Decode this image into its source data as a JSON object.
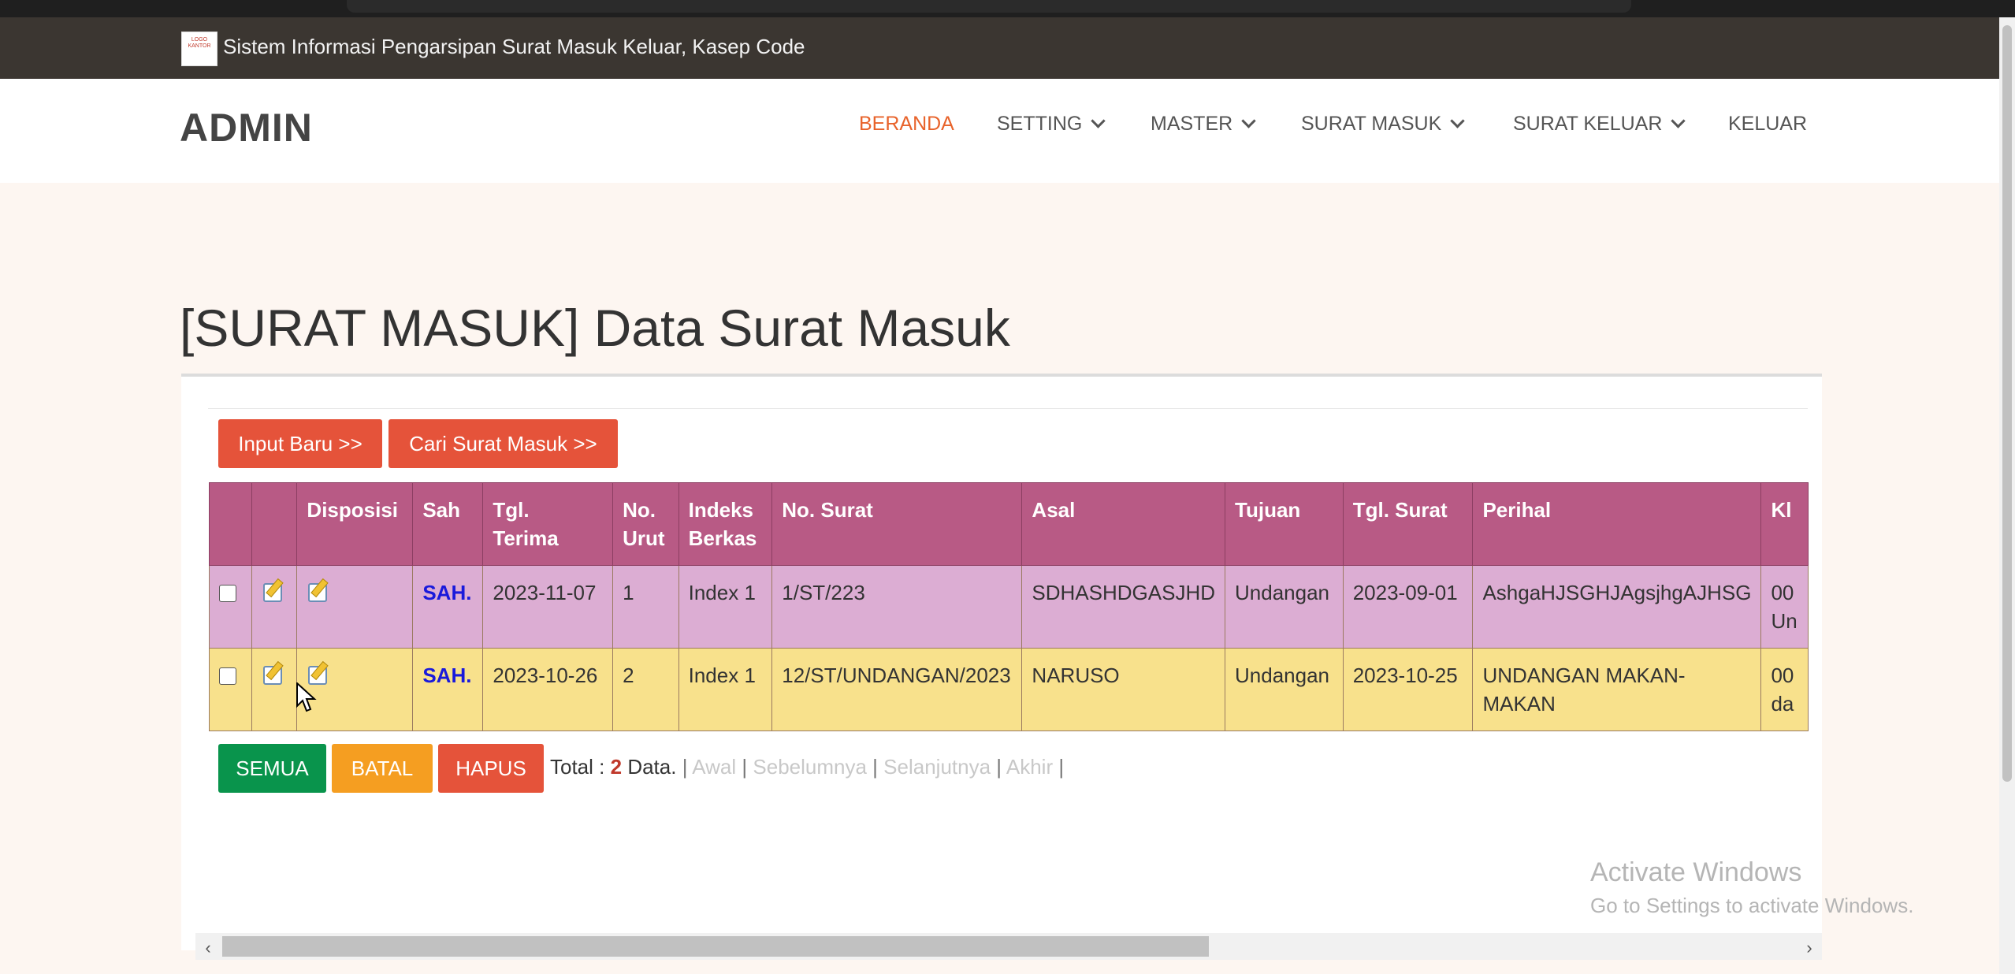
{
  "top_bar": {
    "logo_text": "LOGO KANTOR",
    "title": "Sistem Informasi Pengarsipan Surat Masuk Keluar, Kasep Code"
  },
  "navbar": {
    "brand": "ADMIN",
    "items": [
      {
        "label": "BERANDA",
        "active": true,
        "dropdown": false
      },
      {
        "label": "SETTING",
        "active": false,
        "dropdown": true
      },
      {
        "label": "MASTER",
        "active": false,
        "dropdown": true
      },
      {
        "label": "SURAT MASUK",
        "active": false,
        "dropdown": true
      },
      {
        "label": "SURAT KELUAR",
        "active": false,
        "dropdown": true
      },
      {
        "label": "KELUAR",
        "active": false,
        "dropdown": false
      }
    ]
  },
  "page": {
    "title": "[SURAT MASUK] Data Surat Masuk"
  },
  "actions": {
    "input_baru": "Input Baru >>",
    "cari": "Cari Surat Masuk >>"
  },
  "table": {
    "headers": [
      "",
      "",
      "Disposisi",
      "Sah",
      "Tgl.\nTerima",
      "No.\nUrut",
      "Indeks\nBerkas",
      "No. Surat",
      "Asal",
      "Tujuan",
      "Tgl. Surat",
      "Perihal",
      "Kl"
    ],
    "rows": [
      {
        "sah": "SAH.",
        "tgl_terima": "2023-11-07",
        "no_urut": "1",
        "indeks": "Index 1",
        "no_surat": "1/ST/223",
        "asal": "SDHASHDGASJHD",
        "tujuan": "Undangan",
        "tgl_surat": "2023-09-01",
        "perihal": "AshgaHJSGHJAgsjhgAJHSG",
        "kl": "00\nUn"
      },
      {
        "sah": "SAH.",
        "tgl_terima": "2023-10-26",
        "no_urut": "2",
        "indeks": "Index 1",
        "no_surat": "12/ST/UNDANGAN/2023",
        "asal": "NARUSO",
        "tujuan": "Undangan",
        "tgl_surat": "2023-10-25",
        "perihal": "UNDANGAN MAKAN-\nMAKAN",
        "kl": "00\nda"
      }
    ]
  },
  "bulk_actions": {
    "semua": "SEMUA",
    "batal": "BATAL",
    "hapus": "HAPUS"
  },
  "pager": {
    "total_label": "Total :",
    "total_value": "2",
    "data_label": "Data.",
    "awal": "Awal",
    "sebelumnya": "Sebelumnya",
    "selanjutnya": "Selanjutnya",
    "akhir": "Akhir"
  },
  "watermark": {
    "line1": "Activate Windows",
    "line2": "Go to Settings to activate Windows."
  },
  "colors": {
    "accent": "#e8632b",
    "header_bg": "#b85a85",
    "row_pink": "#dcadd3",
    "row_yellow": "#f8e18c",
    "btn_red": "#e5533a",
    "btn_green": "#09944c",
    "btn_orange": "#f59e21"
  }
}
